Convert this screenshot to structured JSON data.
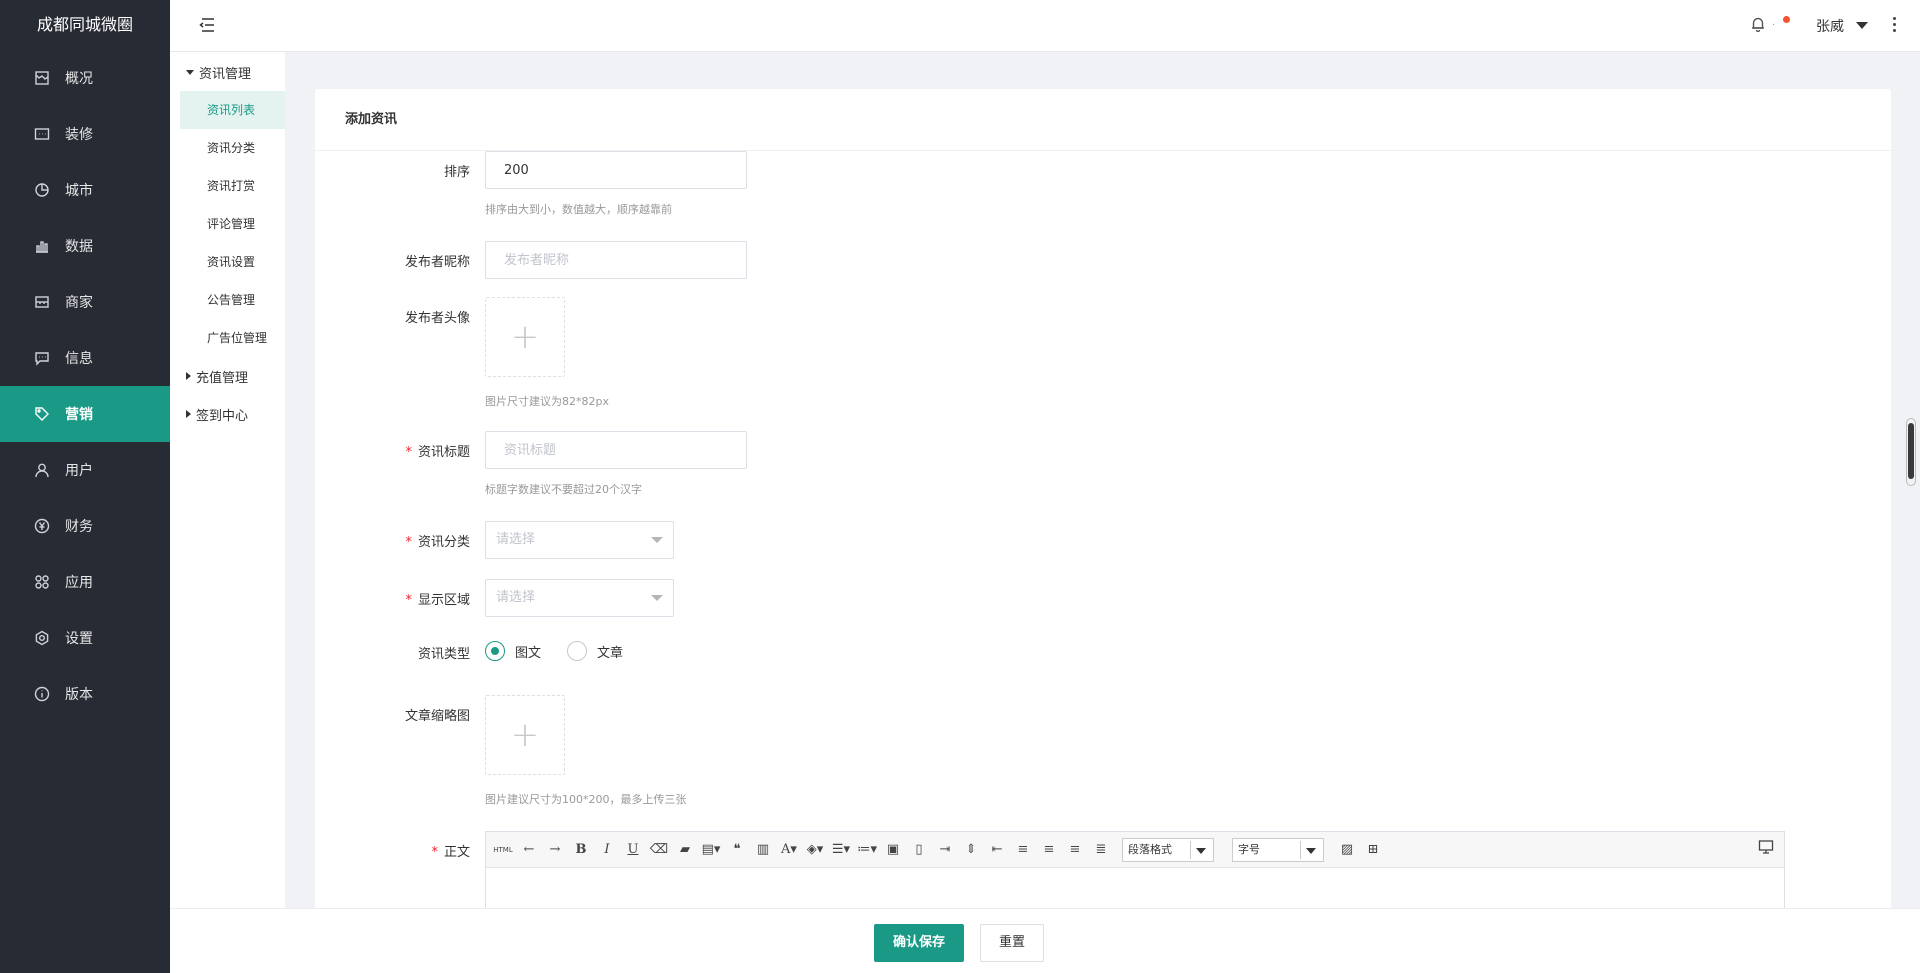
{
  "brand": "成都同城微圈",
  "sidebar": {
    "items": [
      {
        "label": "概况",
        "icon": "dashboard-icon"
      },
      {
        "label": "装修",
        "icon": "decoration-icon"
      },
      {
        "label": "城市",
        "icon": "city-icon"
      },
      {
        "label": "数据",
        "icon": "chart-icon"
      },
      {
        "label": "商家",
        "icon": "shop-icon"
      },
      {
        "label": "信息",
        "icon": "message-icon"
      },
      {
        "label": "营销",
        "icon": "tag-icon",
        "active": true
      },
      {
        "label": "用户",
        "icon": "user-icon"
      },
      {
        "label": "财务",
        "icon": "yen-icon"
      },
      {
        "label": "应用",
        "icon": "apps-icon"
      },
      {
        "label": "设置",
        "icon": "gear-icon"
      },
      {
        "label": "版本",
        "icon": "info-icon"
      }
    ]
  },
  "header": {
    "user_name": "张威"
  },
  "subnav": {
    "group1": "资讯管理",
    "items": [
      "资讯列表",
      "资讯分类",
      "资讯打赏",
      "评论管理",
      "资讯设置",
      "公告管理",
      "广告位管理"
    ],
    "group2": "充值管理",
    "group3": "签到中心"
  },
  "card": {
    "title": "添加资讯"
  },
  "form": {
    "sort_label": "排序",
    "sort_value": "200",
    "sort_help": "排序由大到小，数值越大，顺序越靠前",
    "nickname_label": "发布者昵称",
    "nickname_placeholder": "发布者昵称",
    "avatar_label": "发布者头像",
    "avatar_help": "图片尺寸建议为82*82px",
    "title_label": "资讯标题",
    "title_placeholder": "资讯标题",
    "title_help": "标题字数建议不要超过20个汉字",
    "category_label": "资讯分类",
    "category_placeholder": "请选择",
    "region_label": "显示区域",
    "region_placeholder": "请选择",
    "type_label": "资讯类型",
    "type_options": [
      "图文",
      "文章"
    ],
    "type_selected": "图文",
    "thumb_label": "文章缩略图",
    "thumb_help": "图片建议尺寸为100*200，最多上传三张",
    "body_label": "正文",
    "toolbar": {
      "html": "HTML",
      "paragraph_format": "段落格式",
      "font_size": "字号"
    }
  },
  "footer": {
    "save_label": "确认保存",
    "reset_label": "重置"
  }
}
